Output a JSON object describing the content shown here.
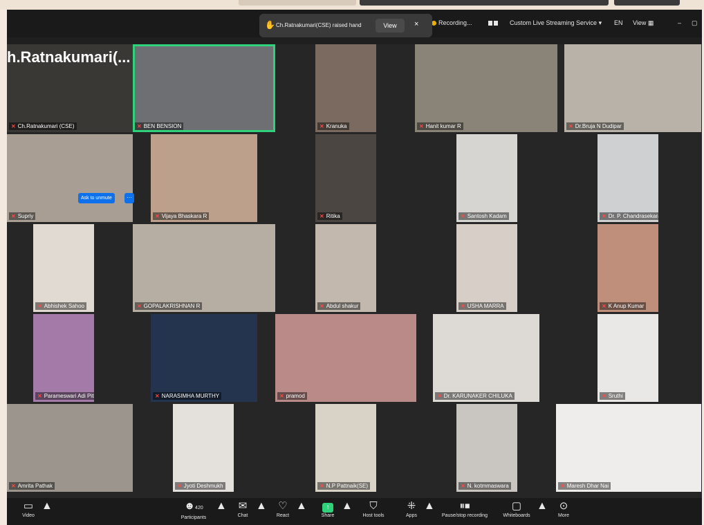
{
  "header": {
    "recording_label": "Recording...",
    "stream_label": "Custom Live Streaming Service",
    "lang_label": "EN",
    "view_label": "View",
    "minimize_label": "–"
  },
  "notification": {
    "text": "Ch.Ratnakumari(CSE) raised hand",
    "view_label": "View",
    "close_label": "×"
  },
  "active_speaker": {
    "display_name": "h.Ratnakumari(..."
  },
  "unmute": {
    "label": "Ask to unmute",
    "more_label": "···"
  },
  "participants": [
    {
      "name": "Ch.Ratnakumari (CSE)"
    },
    {
      "name": "BEN BENSION"
    },
    {
      "name": "Kranuka"
    },
    {
      "name": "Hanit kumar R"
    },
    {
      "name": "Dr.Bruja N Dudipar"
    },
    {
      "name": "Supriy"
    },
    {
      "name": "Vijaya Bhaskara R"
    },
    {
      "name": "Ritika"
    },
    {
      "name": "Santosh Kadam"
    },
    {
      "name": "Dr. P. Chandrasekaran - Professor"
    },
    {
      "name": "Abhishek Sahoo"
    },
    {
      "name": "GOPALAKRISHNAN R"
    },
    {
      "name": "Abdul shakur"
    },
    {
      "name": "USHA MARRA"
    },
    {
      "name": "K Anup Kumar"
    },
    {
      "name": "Parameswari Adi Pithani"
    },
    {
      "name": "NARASIMHA MURTHY"
    },
    {
      "name": "pramod"
    },
    {
      "name": "Dr. KARUNAKER CHILUKA"
    },
    {
      "name": "Sruthi"
    },
    {
      "name": "Amrita Pathak"
    },
    {
      "name": "Jyoti Deshmukh"
    },
    {
      "name": "N.P Pattnaik(SE)"
    },
    {
      "name": "N. kotmmaswara"
    },
    {
      "name": "Maresh Dhar Nai"
    }
  ],
  "toolbar": {
    "video": "Video",
    "participants_count": "420",
    "participants": "Participants",
    "chat": "Chat",
    "react": "React",
    "share": "Share",
    "host_tools": "Host tools",
    "apps": "Apps",
    "recording": "Pause/stop recording",
    "whiteboards": "Whiteboards",
    "more": "More"
  },
  "colors": {
    "accent_green": "#2fd27a",
    "accent_blue": "#0e71eb",
    "mic_muted_red": "#ff4a4a",
    "raise_hand_yellow": "#f4c430"
  }
}
